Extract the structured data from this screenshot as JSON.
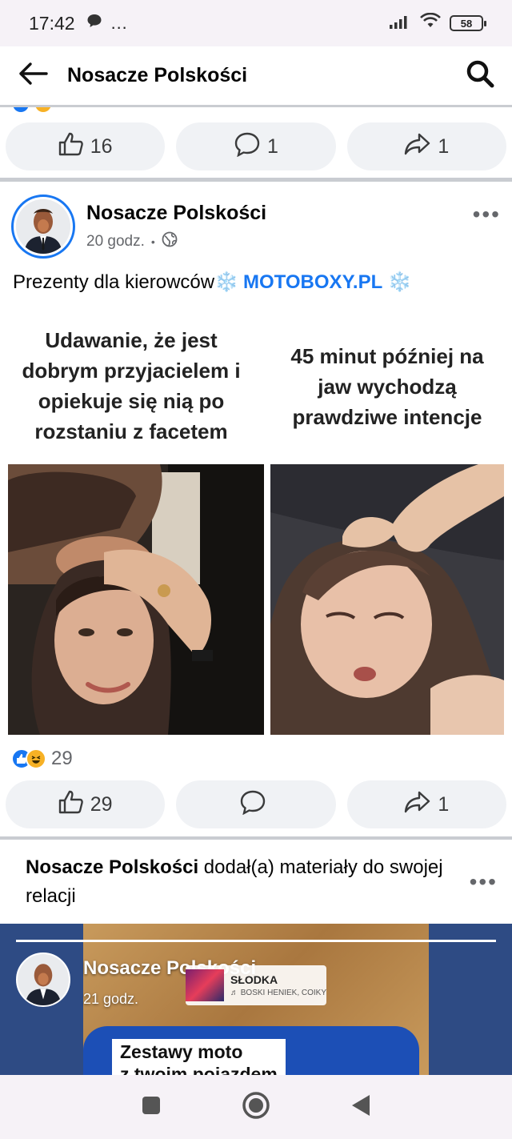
{
  "status_bar": {
    "time": "17:42",
    "extra": "…",
    "battery": "58"
  },
  "app_bar": {
    "title": "Nosacze Polskości"
  },
  "prev_post_actions": {
    "likes": "16",
    "comments": "1",
    "shares": "1"
  },
  "post": {
    "author": "Nosacze Polskości",
    "time": "20 godz.",
    "separator": "•",
    "text_before": "Prezenty dla kierowców",
    "link_text": "MOTOBOXY.PL",
    "snow": "❄️",
    "meme": {
      "left_caption": "Udawanie, że jest dobrym przyjacielem i opiekuje się nią po rozstaniu z facetem",
      "right_caption": "45 minut później na jaw wychodzą prawdziwe intencje"
    },
    "reaction_count": "29",
    "actions": {
      "likes": "29",
      "comments": "",
      "shares": "1"
    }
  },
  "story_row": {
    "author": "Nosacze Polskości",
    "text": "dodał(a) materiały do swojej relacji"
  },
  "story": {
    "author": "Nosacze Polskości",
    "time": "21 godz.",
    "music_title": "SŁODKA",
    "music_artist": "♬ BOSKI HENIEK, COIKY",
    "card_text_1": "Zestawy moto",
    "card_text_2": "z twoim pojazdem"
  },
  "colors": {
    "accent": "#1877f2",
    "pill_bg": "#f0f2f5",
    "divider": "#c9ccd1",
    "story_bg": "#2e4b84"
  }
}
